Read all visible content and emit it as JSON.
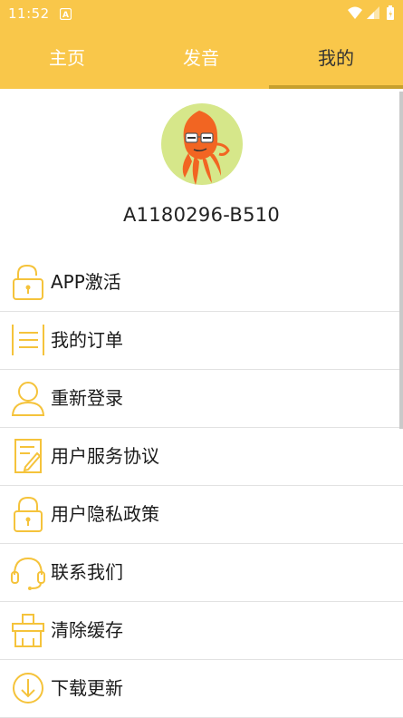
{
  "status": {
    "time": "11:52",
    "notification_icon": "a-icon",
    "accent": "#F9C74A"
  },
  "tabs": [
    {
      "label": "主页"
    },
    {
      "label": "发音"
    },
    {
      "label": "我的"
    }
  ],
  "active_tab": "我的",
  "profile": {
    "username": "A1180296-B510",
    "avatar_icon": "squid-avatar-icon"
  },
  "menu": [
    {
      "label": "APP激活",
      "icon": "lock-icon"
    },
    {
      "label": "我的订单",
      "icon": "order-list-icon"
    },
    {
      "label": "重新登录",
      "icon": "user-icon"
    },
    {
      "label": "用户服务协议",
      "icon": "document-edit-icon"
    },
    {
      "label": "用户隐私政策",
      "icon": "privacy-lock-icon"
    },
    {
      "label": "联系我们",
      "icon": "headset-icon"
    },
    {
      "label": "清除缓存",
      "icon": "clear-cache-icon"
    },
    {
      "label": "下载更新",
      "icon": "download-icon"
    }
  ]
}
